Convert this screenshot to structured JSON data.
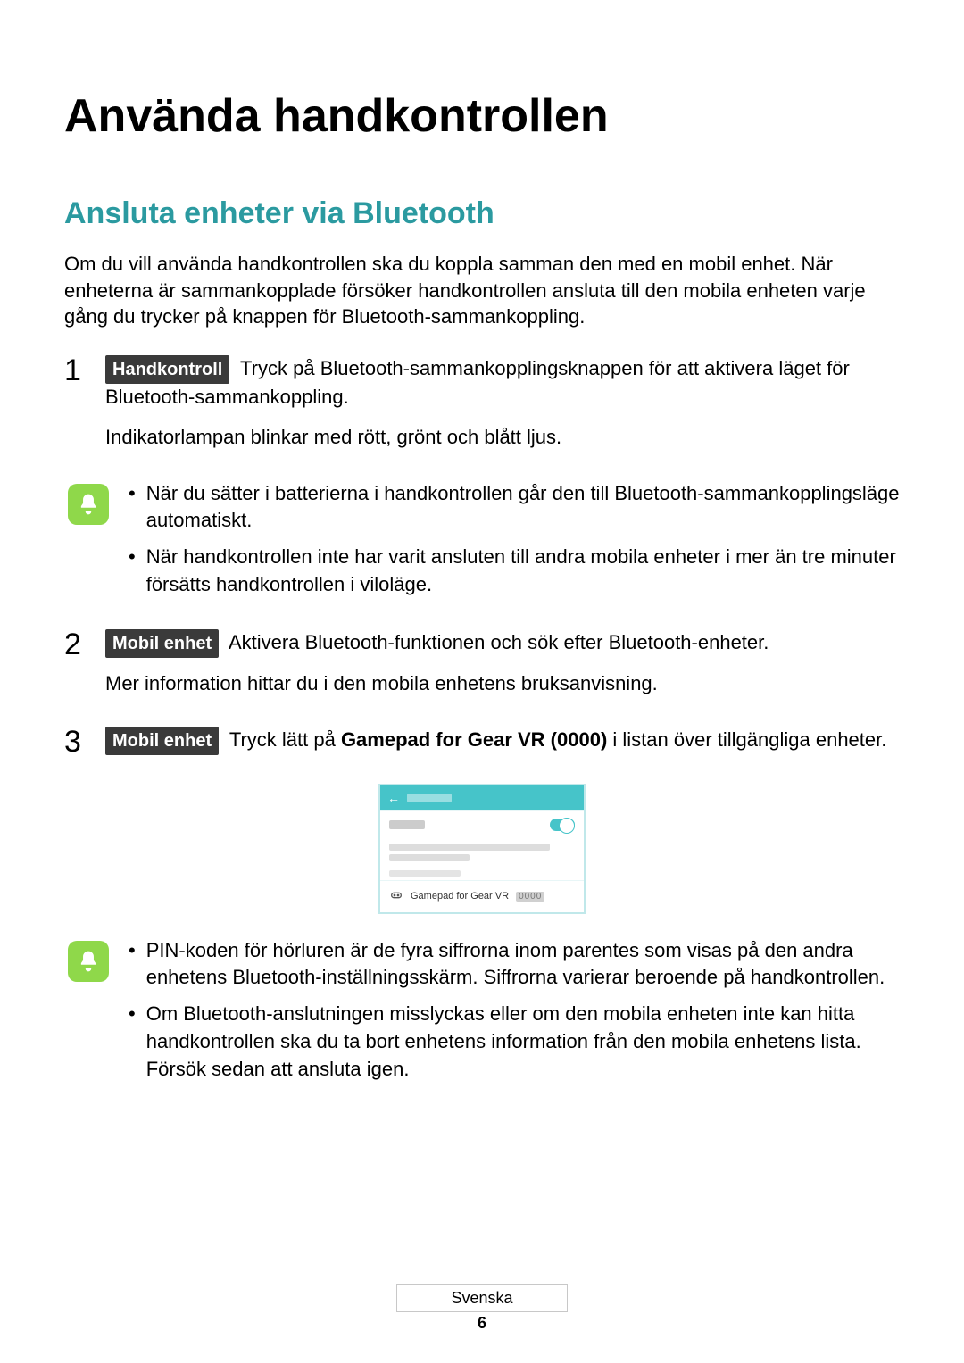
{
  "heading": "Använda handkontrollen",
  "section": "Ansluta enheter via Bluetooth",
  "intro": "Om du vill använda handkontrollen ska du koppla samman den med en mobil enhet. När enheterna är sammankopplade försöker handkontrollen ansluta till den mobila enheten varje gång du trycker på knappen för Bluetooth-sammankoppling.",
  "steps": {
    "s1": {
      "num": "1",
      "badge": "Handkontroll",
      "text_after_badge": " Tryck på Bluetooth-sammankopplingsknappen för att aktivera läget för Bluetooth-sammankoppling.",
      "line2": "Indikatorlampan blinkar med rött, grönt och blått ljus."
    },
    "s2": {
      "num": "2",
      "badge": "Mobil enhet",
      "text_after_badge": " Aktivera Bluetooth-funktionen och sök efter Bluetooth-enheter.",
      "line2": "Mer information hittar du i den mobila enhetens bruksanvisning."
    },
    "s3": {
      "num": "3",
      "badge": "Mobil enhet",
      "text_before_bold": " Tryck lätt på ",
      "bold": "Gamepad for Gear VR (0000)",
      "text_after_bold": " i listan över tillgängliga enheter."
    }
  },
  "note1": {
    "b1": "När du sätter i batterierna i handkontrollen går den till Bluetooth-sammankopplingsläge automatiskt.",
    "b2": "När handkontrollen inte har varit ansluten till andra mobila enheter i mer än tre minuter försätts handkontrollen i viloläge."
  },
  "note2": {
    "b1": "PIN-koden för hörluren är de fyra siffrorna inom parentes som visas på den andra enhetens Bluetooth-inställningsskärm. Siffrorna varierar beroende på handkontrollen.",
    "b2": "Om Bluetooth-anslutningen misslyckas eller om den mobila enheten inte kan hitta handkontrollen ska du ta bort enhetens information från den mobila enhetens lista. Försök sedan att ansluta igen."
  },
  "bt_screen": {
    "device_label": "Gamepad for Gear VR",
    "pin_placeholder": "0000"
  },
  "footer": {
    "lang": "Svenska",
    "page": "6"
  },
  "bullet": "•"
}
